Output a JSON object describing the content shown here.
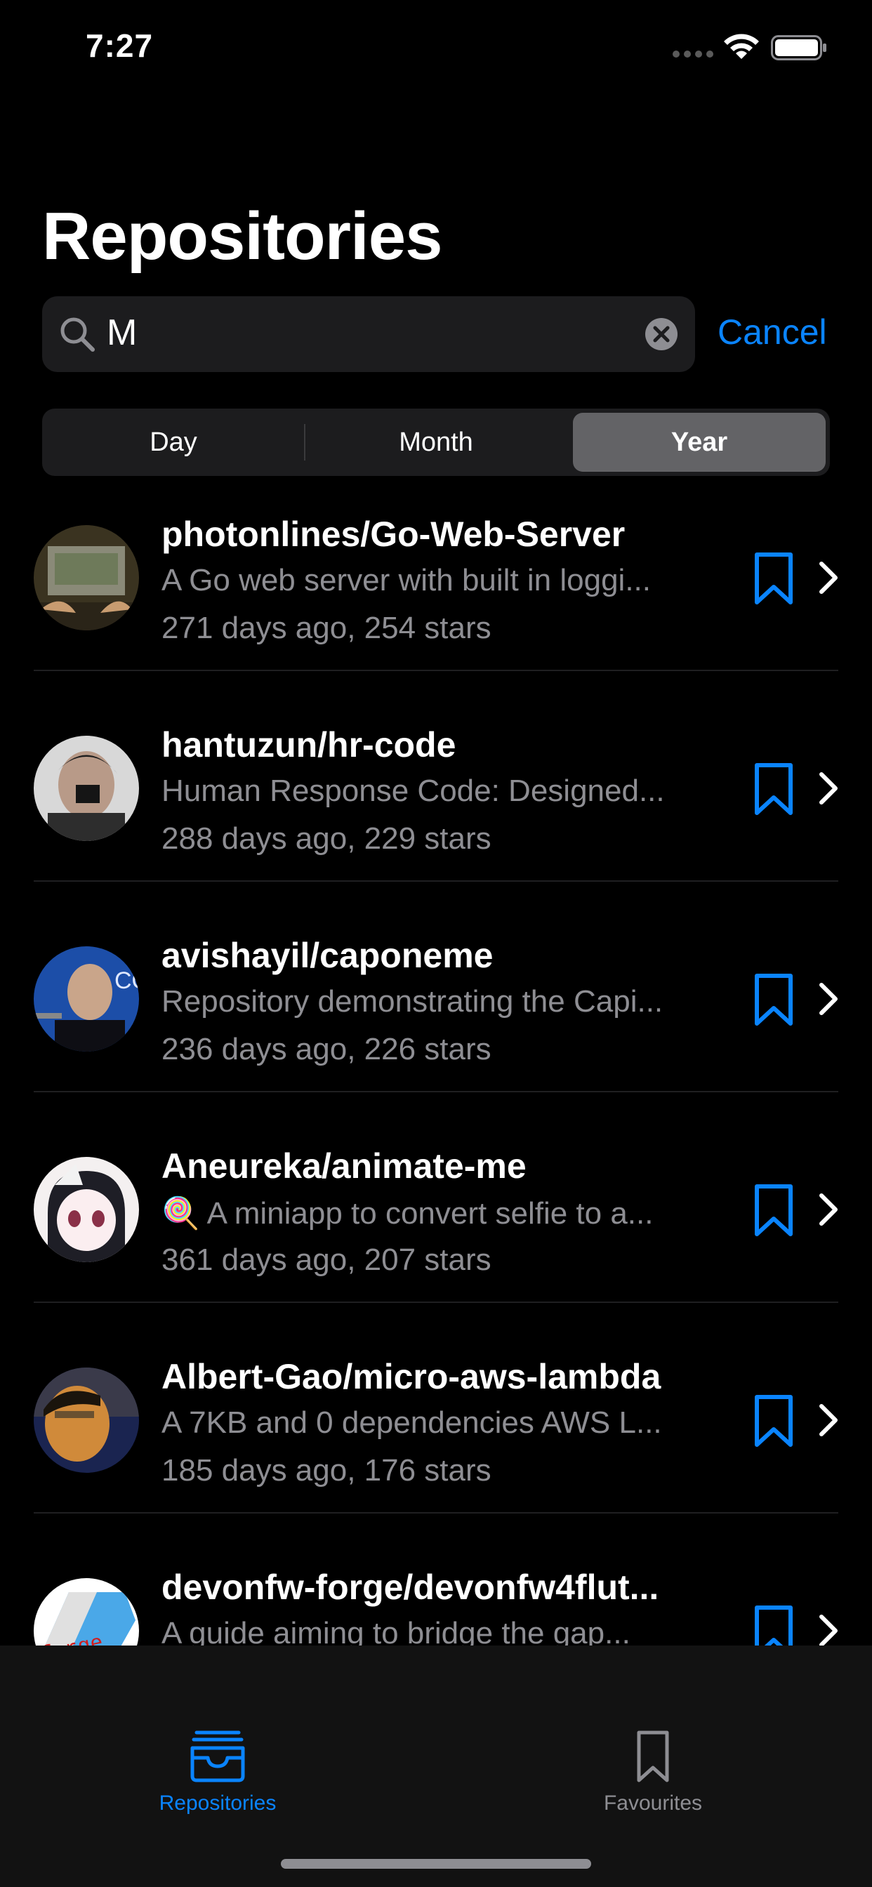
{
  "status_bar": {
    "time": "7:27"
  },
  "title": "Repositories",
  "search": {
    "value": "M",
    "cancel_label": "Cancel"
  },
  "segments": {
    "day": "Day",
    "month": "Month",
    "year": "Year",
    "selected": "Year"
  },
  "repos": [
    {
      "name": "photonlines/Go-Web-Server",
      "description": "A Go web server with built in loggi...",
      "meta": "271 days ago, 254 stars"
    },
    {
      "name": "hantuzun/hr-code",
      "description": "Human Response Code: Designed...",
      "meta": "288 days ago, 229 stars"
    },
    {
      "name": "avishayil/caponeme",
      "description": "Repository demonstrating the Capi...",
      "meta": "236 days ago, 226 stars"
    },
    {
      "name": "Aneureka/animate-me",
      "description": "🍭 A miniapp to convert selfie to a...",
      "meta": "361 days ago, 207 stars"
    },
    {
      "name": "Albert-Gao/micro-aws-lambda",
      "description": "A 7KB and 0 dependencies AWS L...",
      "meta": "185 days ago, 176 stars"
    },
    {
      "name": "devonfw-forge/devonfw4flut...",
      "description": "A guide aiming to bridge the gap...",
      "meta": ""
    }
  ],
  "tabs": {
    "repositories": "Repositories",
    "favourites": "Favourites",
    "selected": "Repositories"
  },
  "colors": {
    "accent": "#0a84ff",
    "background": "#000000",
    "secondary_text": "#8e8e93"
  }
}
